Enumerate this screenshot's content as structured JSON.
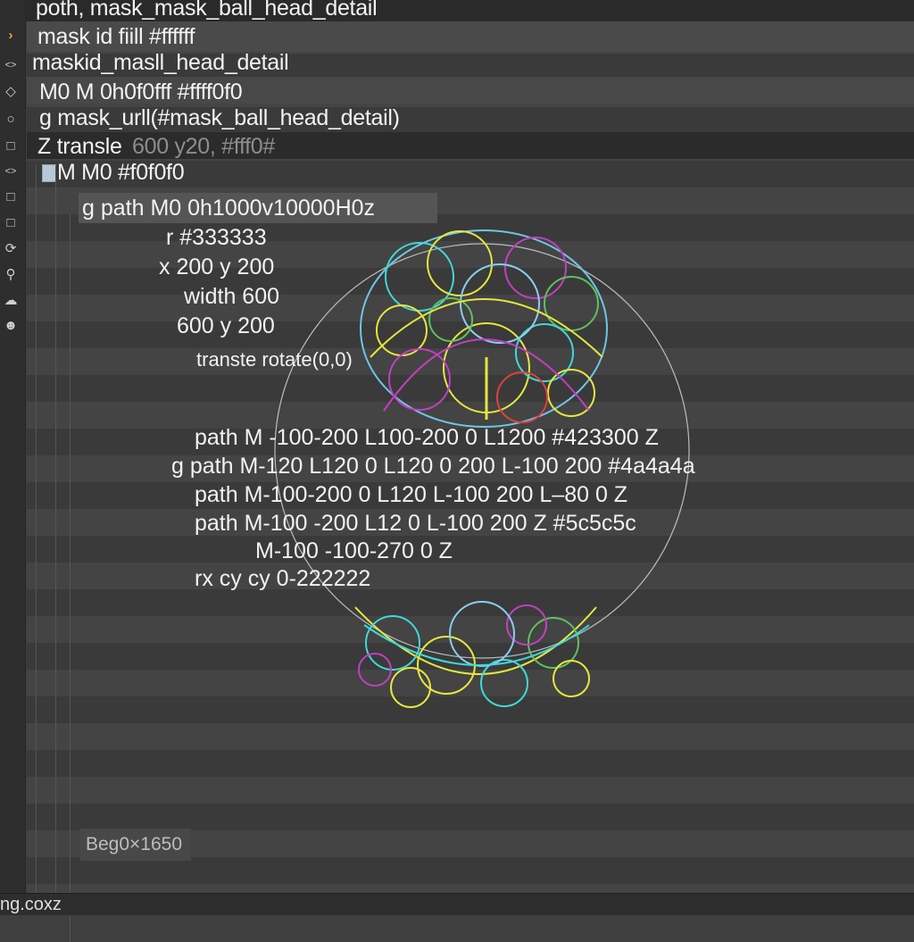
{
  "title_row": {
    "text": "poth,  mask_mask_ball_head_detail"
  },
  "tree": {
    "rows": [
      {
        "text": "mask id fiill #ffffff"
      },
      {
        "text": "maskid_masll_head_detail"
      },
      {
        "text": "M0  M  0h0f0fff #ffff0f0"
      },
      {
        "text": "g  mask_urll(#mask_ball_head_detail)"
      },
      {
        "text_a": "Z  transle",
        "text_b": "600 y20, #fff0#"
      },
      {
        "text": "M   M0 #f0f0f0"
      }
    ]
  },
  "code_lines": [
    {
      "text": "g  path  M0 0h1000v10000H0z"
    },
    {
      "text": "r  #333333"
    },
    {
      "text": "x 200 y 200"
    },
    {
      "text": "width 600"
    },
    {
      "text": "600 y 200"
    },
    {
      "text": "transte rotate(0,0)"
    },
    {
      "text": "path  M -100-200 L100-200  0 L1200  #423300  Z"
    },
    {
      "text": "g  path  M-120 L120 0  L120 0 200 L-100 200  #4a4a4a"
    },
    {
      "text": "path  M-100-200 0 L120 L-100 200  L–80 0  Z"
    },
    {
      "text": "path  M-100 -200  L12  0  L-100  200  Z  #5c5c5c"
    },
    {
      "text": "M-100 -100-270  0  Z"
    },
    {
      "text": "rx cy  cy  0-222222"
    }
  ],
  "coord_readout": "Beg0×1650",
  "status_bar": {
    "text": "ng.coxz"
  },
  "rail_icons": [
    "chevron-right-icon",
    "code-icon",
    "diamond-icon",
    "circle-icon",
    "square-icon",
    "code-icon",
    "square-icon",
    "square-icon",
    "refresh-icon",
    "search-icon",
    "cloud-icon",
    "robot-icon"
  ],
  "colors": {
    "accent": "#f0a040",
    "background": "#3f3f3f",
    "ball_yellow": "#e6e640",
    "ball_cyan": "#40d8d8",
    "ball_magenta": "#c040c0",
    "ball_green": "#60c060"
  }
}
